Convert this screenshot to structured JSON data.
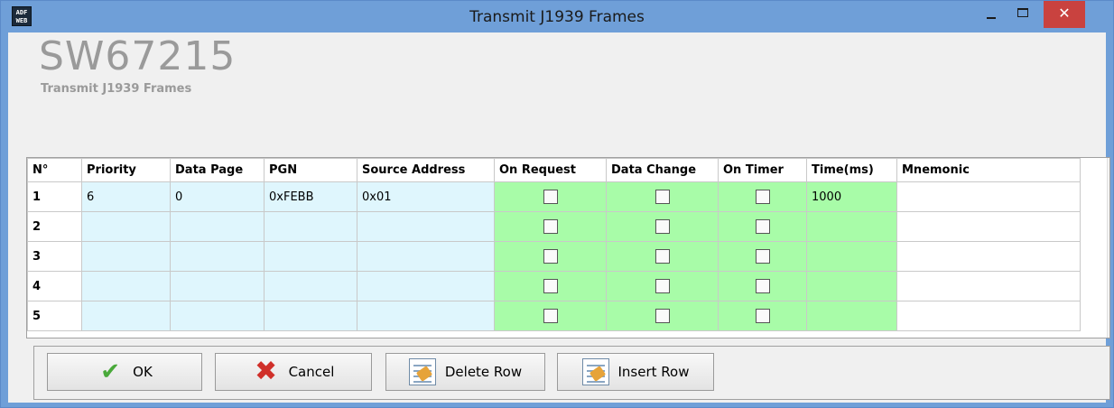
{
  "window": {
    "title": "Transmit J1939 Frames",
    "app_icon_text_top": "ADF",
    "app_icon_text_bottom": "WEB",
    "minimize_glyph": "_",
    "maximize_glyph": "□",
    "close_glyph": "✕"
  },
  "header": {
    "product": "SW67215",
    "subtitle": "Transmit J1939 Frames"
  },
  "grid": {
    "columns": [
      "N°",
      "Priority",
      "Data Page",
      "PGN",
      "Source Address",
      "On Request",
      "Data Change",
      "On Timer",
      "Time(ms)",
      "Mnemonic"
    ],
    "rows": [
      {
        "n": "1",
        "priority": "6",
        "data_page": "0",
        "pgn": "0xFEBB",
        "source_address": "0x01",
        "on_request": false,
        "data_change": false,
        "on_timer": false,
        "time_ms": "1000",
        "mnemonic": ""
      },
      {
        "n": "2",
        "priority": "",
        "data_page": "",
        "pgn": "",
        "source_address": "",
        "on_request": false,
        "data_change": false,
        "on_timer": false,
        "time_ms": "",
        "mnemonic": ""
      },
      {
        "n": "3",
        "priority": "",
        "data_page": "",
        "pgn": "",
        "source_address": "",
        "on_request": false,
        "data_change": false,
        "on_timer": false,
        "time_ms": "",
        "mnemonic": ""
      },
      {
        "n": "4",
        "priority": "",
        "data_page": "",
        "pgn": "",
        "source_address": "",
        "on_request": false,
        "data_change": false,
        "on_timer": false,
        "time_ms": "",
        "mnemonic": ""
      },
      {
        "n": "5",
        "priority": "",
        "data_page": "",
        "pgn": "",
        "source_address": "",
        "on_request": false,
        "data_change": false,
        "on_timer": false,
        "time_ms": "",
        "mnemonic": ""
      }
    ]
  },
  "buttons": {
    "ok": "OK",
    "cancel": "Cancel",
    "delete_row": "Delete Row",
    "insert_row": "Insert Row"
  },
  "icons": {
    "ok": "check-icon",
    "cancel": "x-icon",
    "delete_row": "delete-row-icon",
    "insert_row": "insert-row-icon"
  },
  "colors": {
    "titlebar": "#6f9fd8",
    "close_button": "#c9423f",
    "blue_cells": "#dff6fd",
    "green_cells": "#a8fca8",
    "header_gray": "#9a9a9a"
  }
}
